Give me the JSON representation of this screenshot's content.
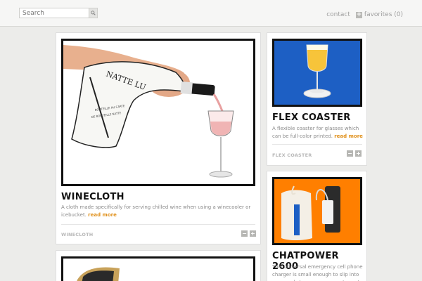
{
  "search": {
    "placeholder": "Search"
  },
  "nav": {
    "contact": "contact",
    "favorites": "favorites (0)"
  },
  "cards": [
    {
      "title": "WINECLOTH",
      "description": "A cloth made specifically for serving chilled wine when using a winecooler or icebucket.",
      "read_more": "read more",
      "tag": "WINECLOTH"
    },
    {
      "title": "FLEX COASTER",
      "description": "A flexible coaster for glasses which can be full-color printed.",
      "read_more": "read more",
      "tag": "FLEX COASTER"
    },
    {
      "title": "CHATPOWER 2600",
      "description": "This universal emergency cell phone charger is small enough to slip into your pocket or purse, so you've got more for",
      "read_more": "",
      "tag": ""
    }
  ],
  "colors": {
    "accent": "#e0901a",
    "blue_photo_bg": "#1d5fc4",
    "orange_photo_bg": "#ff7f00"
  }
}
